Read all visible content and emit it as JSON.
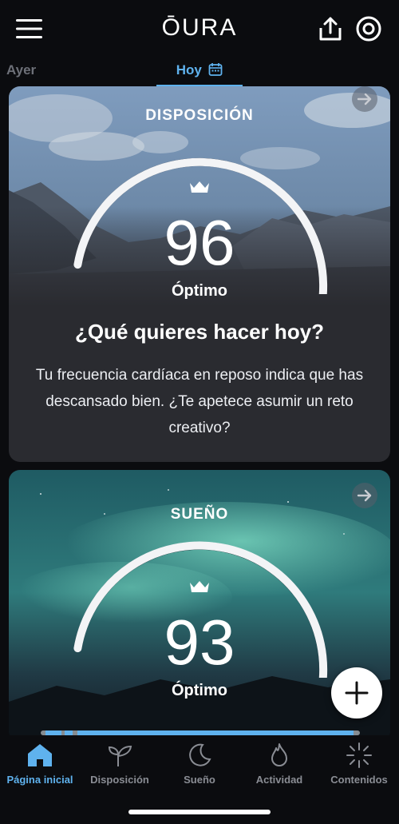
{
  "header": {
    "logo": "ŌURA",
    "menu_icon": "hamburger-menu-icon",
    "share_icon": "share-icon",
    "ring_icon": "ring-icon"
  },
  "day_tabs": [
    {
      "label": "Ayer",
      "active": false
    },
    {
      "label": "Hoy",
      "active": true,
      "icon": "calendar-icon"
    }
  ],
  "readiness": {
    "title": "DISPOSICIÓN",
    "score": "96",
    "status": "Óptimo",
    "headline": "¿Qué quieres hacer hoy?",
    "message": "Tu frecuencia cardíaca en reposo indica que has descansado bien. ¿Te apetece asumir un reto creativo?",
    "score_fraction": 0.96
  },
  "sleep": {
    "title": "SUEÑO",
    "score": "93",
    "status": "Óptimo",
    "score_fraction": 0.93
  },
  "colors": {
    "accent": "#5fb2ee",
    "background": "#0b0c0f",
    "card": "#2a2b30"
  },
  "bottom_nav": [
    {
      "label": "Página inicial",
      "icon": "home-icon",
      "active": true
    },
    {
      "label": "Disposición",
      "icon": "sprout-icon",
      "active": false
    },
    {
      "label": "Sueño",
      "icon": "moon-icon",
      "active": false
    },
    {
      "label": "Actividad",
      "icon": "flame-icon",
      "active": false
    },
    {
      "label": "Contenidos",
      "icon": "sparkle-icon",
      "active": false
    }
  ]
}
